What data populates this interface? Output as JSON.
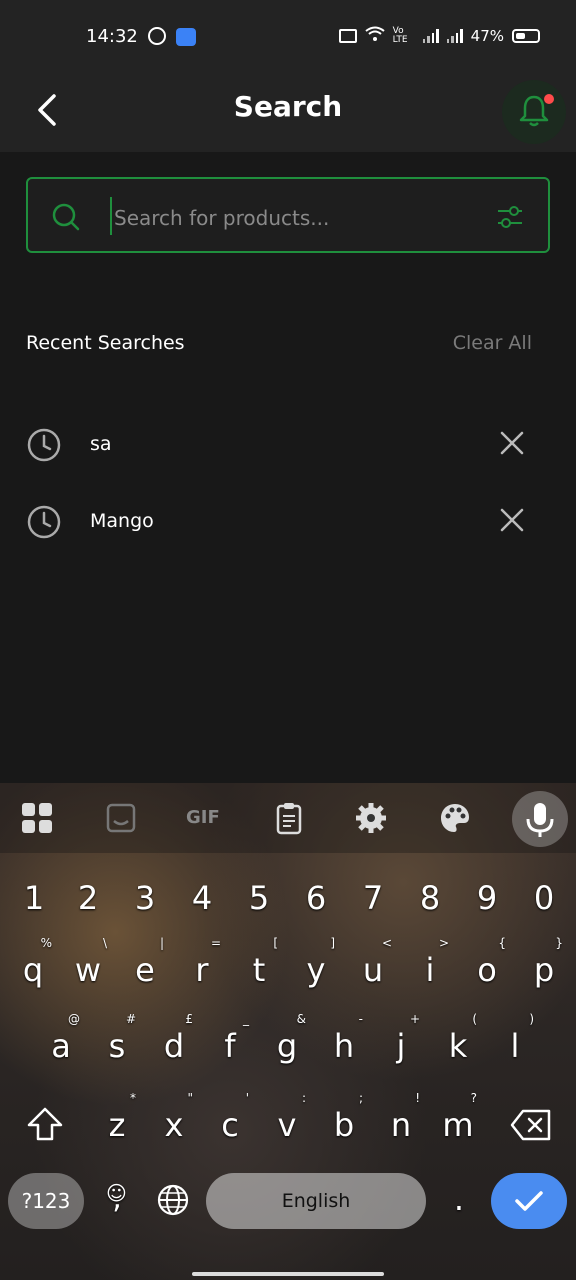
{
  "status_bar": {
    "time": "14:32",
    "battery_percent": "47%",
    "battery_level": 0.47,
    "network_label": "Vo LTE"
  },
  "header": {
    "title": "Search"
  },
  "search": {
    "placeholder": "Search for products..."
  },
  "recent": {
    "heading": "Recent Searches",
    "clear_label": "Clear All",
    "items": [
      {
        "label": "sa"
      },
      {
        "label": "Mango"
      }
    ]
  },
  "keyboard": {
    "numbers": [
      "1",
      "2",
      "3",
      "4",
      "5",
      "6",
      "7",
      "8",
      "9",
      "0"
    ],
    "row1": [
      {
        "k": "q",
        "s": "%"
      },
      {
        "k": "w",
        "s": "\\"
      },
      {
        "k": "e",
        "s": "|"
      },
      {
        "k": "r",
        "s": "="
      },
      {
        "k": "t",
        "s": "["
      },
      {
        "k": "y",
        "s": "]"
      },
      {
        "k": "u",
        "s": "<"
      },
      {
        "k": "i",
        "s": ">"
      },
      {
        "k": "o",
        "s": "{"
      },
      {
        "k": "p",
        "s": "}"
      }
    ],
    "row2": [
      {
        "k": "a",
        "s": "@"
      },
      {
        "k": "s",
        "s": "#"
      },
      {
        "k": "d",
        "s": "£"
      },
      {
        "k": "f",
        "s": "_"
      },
      {
        "k": "g",
        "s": "&"
      },
      {
        "k": "h",
        "s": "-"
      },
      {
        "k": "j",
        "s": "+"
      },
      {
        "k": "k",
        "s": "("
      },
      {
        "k": "l",
        "s": ")"
      }
    ],
    "row3": [
      {
        "k": "z",
        "s": "*"
      },
      {
        "k": "x",
        "s": "\""
      },
      {
        "k": "c",
        "s": "'"
      },
      {
        "k": "v",
        "s": ":"
      },
      {
        "k": "b",
        "s": ";"
      },
      {
        "k": "n",
        "s": "!"
      },
      {
        "k": "m",
        "s": "?"
      }
    ],
    "symbols_label": "?123",
    "space_label": "English",
    "comma": ",",
    "period": ".",
    "gif_label": "GIF"
  },
  "colors": {
    "accent": "#1f8f3d",
    "enter": "#4a8cf0",
    "notification_dot": "#ff4b4b"
  }
}
